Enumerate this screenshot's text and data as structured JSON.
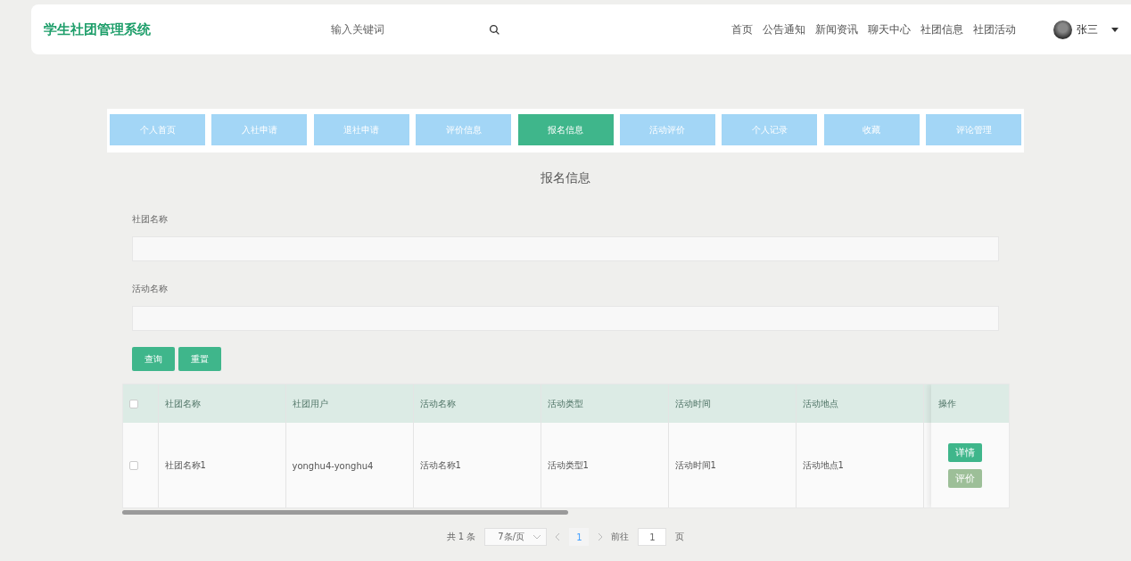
{
  "header": {
    "logo": "学生社团管理系统",
    "search": {
      "placeholder": "输入关键词"
    },
    "nav": [
      {
        "label": "首页"
      },
      {
        "label": "公告通知"
      },
      {
        "label": "新闻资讯"
      },
      {
        "label": "聊天中心"
      },
      {
        "label": "社团信息"
      },
      {
        "label": "社团活动"
      }
    ],
    "user": "张三"
  },
  "tabs": [
    {
      "label": "个人首页",
      "selected": false
    },
    {
      "label": "入社申请",
      "selected": false
    },
    {
      "label": "退社申请",
      "selected": false
    },
    {
      "label": "评价信息",
      "selected": false
    },
    {
      "label": "报名信息",
      "selected": true
    },
    {
      "label": "活动评价",
      "selected": false
    },
    {
      "label": "个人记录",
      "selected": false
    },
    {
      "label": "收藏",
      "selected": false
    },
    {
      "label": "评论管理",
      "selected": false
    }
  ],
  "page_title": "报名信息",
  "filters": [
    {
      "label": "社团名称"
    },
    {
      "label": "活动名称"
    }
  ],
  "buttons": [
    {
      "label": "查询"
    },
    {
      "label": "重置"
    }
  ],
  "table": {
    "all_checked": false,
    "columns": [
      "社团名称",
      "社团用户",
      "活动名称",
      "活动类型",
      "活动时间",
      "活动地点"
    ],
    "action_column": "操作",
    "rows": [
      {
        "checked": false,
        "cells": [
          "社团名称1",
          "yonghu4-yonghu4",
          "活动名称1",
          "活动类型1",
          "活动时间1",
          "活动地点1"
        ],
        "actions": [
          {
            "label": "详情",
            "kind": "primary"
          },
          {
            "label": "评价",
            "kind": "muted"
          }
        ]
      }
    ]
  },
  "pagination": {
    "total": "共 1 条",
    "page_size": "7条/页",
    "pages": [
      {
        "label": "1",
        "selected": true
      }
    ],
    "goto_label": "前往",
    "goto_value": "1",
    "page_suffix": "页"
  }
}
